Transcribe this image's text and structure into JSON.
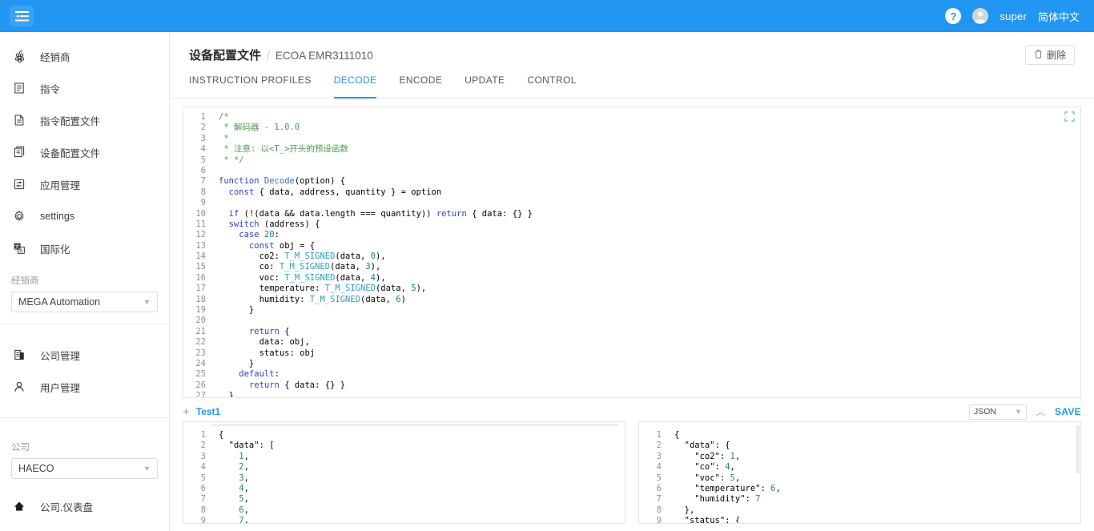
{
  "topbar": {
    "menu_icon": "menu-collapse-icon",
    "help_label": "?",
    "user_name": "super",
    "language": "简体中文"
  },
  "sidebar": {
    "nav_primary": [
      {
        "icon": "grapes-icon",
        "label": "经销商"
      },
      {
        "icon": "document-lines-icon",
        "label": "指令"
      },
      {
        "icon": "document-text-icon",
        "label": "指令配置文件"
      },
      {
        "icon": "copy-documents-icon",
        "label": "设备配置文件"
      },
      {
        "icon": "sliders-box-icon",
        "label": "应用管理"
      },
      {
        "icon": "gear-icon",
        "label": "settings"
      },
      {
        "icon": "translate-icon",
        "label": "国际化"
      }
    ],
    "dealer_select": {
      "label": "经销商",
      "value": "MEGA Automation"
    },
    "nav_secondary": [
      {
        "icon": "building-icon",
        "label": "公司管理"
      },
      {
        "icon": "user-icon",
        "label": "用户管理"
      }
    ],
    "company_select": {
      "label": "公司",
      "value": "HAECO"
    },
    "nav_tertiary": [
      {
        "icon": "home-icon",
        "label": "公司.仪表盘"
      }
    ]
  },
  "breadcrumb": {
    "root": "设备配置文件",
    "separator": "/",
    "current": "ECOA EMR3111010"
  },
  "actions": {
    "delete_label": "删除",
    "delete_icon": "trash-icon"
  },
  "tabs": [
    {
      "label": "INSTRUCTION PROFILES",
      "active": false
    },
    {
      "label": "DECODE",
      "active": true
    },
    {
      "label": "ENCODE",
      "active": false
    },
    {
      "label": "UPDATE",
      "active": false
    },
    {
      "label": "CONTROL",
      "active": false
    }
  ],
  "editor": {
    "expand_icon": "fullscreen-icon",
    "line_count": 29,
    "lines": [
      "/*",
      " * 解码器 - 1.0.0",
      " *",
      " * 注意: 以<T_>开头的预设函数",
      " * */",
      "",
      "function Decode(option) {",
      "  const { data, address, quantity } = option",
      "",
      "  if (!(data && data.length === quantity)) return { data: {} }",
      "  switch (address) {",
      "    case 20:",
      "      const obj = {",
      "        co2: T_M_SIGNED(data, 0),",
      "        co: T_M_SIGNED(data, 3),",
      "        voc: T_M_SIGNED(data, 4),",
      "        temperature: T_M_SIGNED(data, 5),",
      "        humidity: T_M_SIGNED(data, 6)",
      "      }",
      "",
      "      return {",
      "        data: obj,",
      "        status: obj",
      "      }",
      "    default:",
      "      return { data: {} }",
      "  }",
      "}",
      ""
    ]
  },
  "test_panel": {
    "add_icon": "plus-icon",
    "tab_label": "Test1",
    "format": "JSON",
    "collapse_icon": "caret-up-icon",
    "save_label": "SAVE",
    "input": {
      "lines": [
        "{",
        "  \"data\": [",
        "    1,",
        "    2,",
        "    3,",
        "    4,",
        "    5,",
        "    6,",
        "    7,"
      ]
    },
    "output": {
      "lines": [
        "{",
        "  \"data\": {",
        "    \"co2\": 1,",
        "    \"co\": 4,",
        "    \"voc\": 5,",
        "    \"temperature\": 6,",
        "    \"humidity\": 7",
        "  },",
        "  \"status\": {"
      ]
    }
  },
  "colors": {
    "accent": "#2196f3",
    "topbar": "#2196f3",
    "comment": "#4e9a52",
    "keyword": "#2b42c4",
    "builtin": "#2e9fb8",
    "json_key": "#b03a48",
    "json_num": "#2e8b57"
  }
}
